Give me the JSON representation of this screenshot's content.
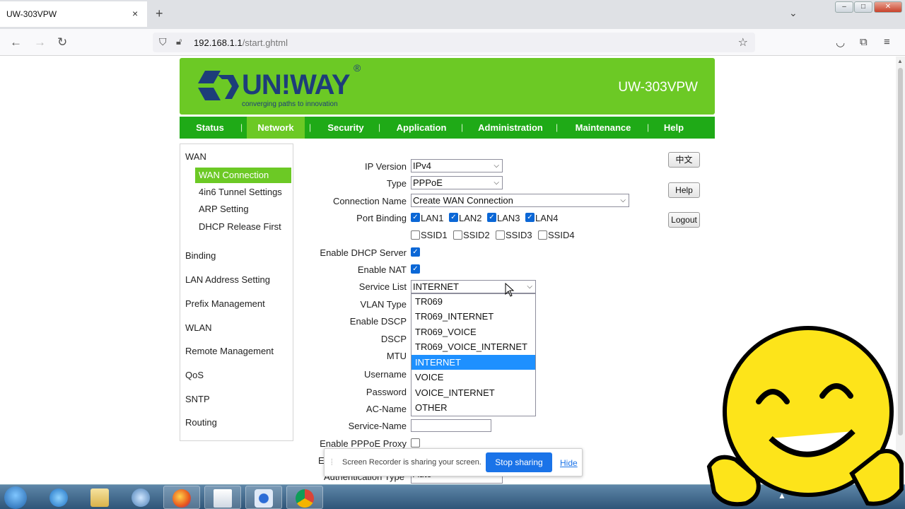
{
  "browser": {
    "tab_title": "UW-303VPW",
    "tab_close": "×",
    "new_tab": "+",
    "url_host": "192.168.1.1",
    "url_path": "/start.ghtml"
  },
  "router": {
    "logo_text": "UN!WAY",
    "logo_reg": "®",
    "logo_tagline": "converging paths to innovation",
    "model": "UW-303VPW"
  },
  "menu": [
    {
      "label": "Status"
    },
    {
      "label": "Network"
    },
    {
      "label": "Security"
    },
    {
      "label": "Application"
    },
    {
      "label": "Administration"
    },
    {
      "label": "Maintenance"
    },
    {
      "label": "Help"
    }
  ],
  "sidebar": {
    "wan": "WAN",
    "wan_items": [
      "WAN Connection",
      "4in6 Tunnel Settings",
      "ARP Setting",
      "DHCP Release First"
    ],
    "items": [
      "Binding",
      "LAN Address Setting",
      "Prefix Management",
      "WLAN",
      "Remote Management",
      "QoS",
      "SNTP",
      "Routing"
    ]
  },
  "form": {
    "ip_version": {
      "label": "IP Version",
      "value": "IPv4"
    },
    "type": {
      "label": "Type",
      "value": "PPPoE"
    },
    "connection_name": {
      "label": "Connection Name",
      "value": "Create WAN Connection"
    },
    "port_binding": {
      "label": "Port Binding",
      "lan": [
        {
          "label": "LAN1",
          "checked": true
        },
        {
          "label": "LAN2",
          "checked": true
        },
        {
          "label": "LAN3",
          "checked": true
        },
        {
          "label": "LAN4",
          "checked": true
        }
      ],
      "ssid": [
        {
          "label": "SSID1",
          "checked": false
        },
        {
          "label": "SSID2",
          "checked": false
        },
        {
          "label": "SSID3",
          "checked": false
        },
        {
          "label": "SSID4",
          "checked": false
        }
      ]
    },
    "enable_dhcp_server": {
      "label": "Enable DHCP Server",
      "checked": true
    },
    "enable_nat": {
      "label": "Enable NAT",
      "checked": true
    },
    "service_list": {
      "label": "Service List",
      "value": "INTERNET",
      "options": [
        "TR069",
        "TR069_INTERNET",
        "TR069_VOICE",
        "TR069_VOICE_INTERNET",
        "INTERNET",
        "VOICE",
        "VOICE_INTERNET",
        "OTHER"
      ],
      "selected_index": 4
    },
    "vlan_type": {
      "label": "VLAN Type"
    },
    "enable_dscp": {
      "label": "Enable DSCP"
    },
    "dscp": {
      "label": "DSCP"
    },
    "mtu": {
      "label": "MTU"
    },
    "username": {
      "label": "Username"
    },
    "password": {
      "label": "Password"
    },
    "ac_name": {
      "label": "AC-Name"
    },
    "service_name": {
      "label": "Service-Name",
      "value": ""
    },
    "enable_pppoe_proxy": {
      "label": "Enable PPPoE Proxy",
      "checked": false
    },
    "authentication_type": {
      "label": "Authentication Type",
      "value": "Auto"
    },
    "partial_label": "E"
  },
  "buttons": {
    "chinese": "中文",
    "help": "Help",
    "logout": "Logout"
  },
  "share_notice": {
    "text": "Screen Recorder is sharing your screen.",
    "stop": "Stop sharing",
    "hide": "Hide"
  },
  "colors": {
    "banner_green": "#6cc925",
    "menu_green": "#1faa17",
    "logo_blue": "#1d3d7a",
    "select_blue": "#1e90ff",
    "checkbox_blue": "#0b67d6"
  }
}
